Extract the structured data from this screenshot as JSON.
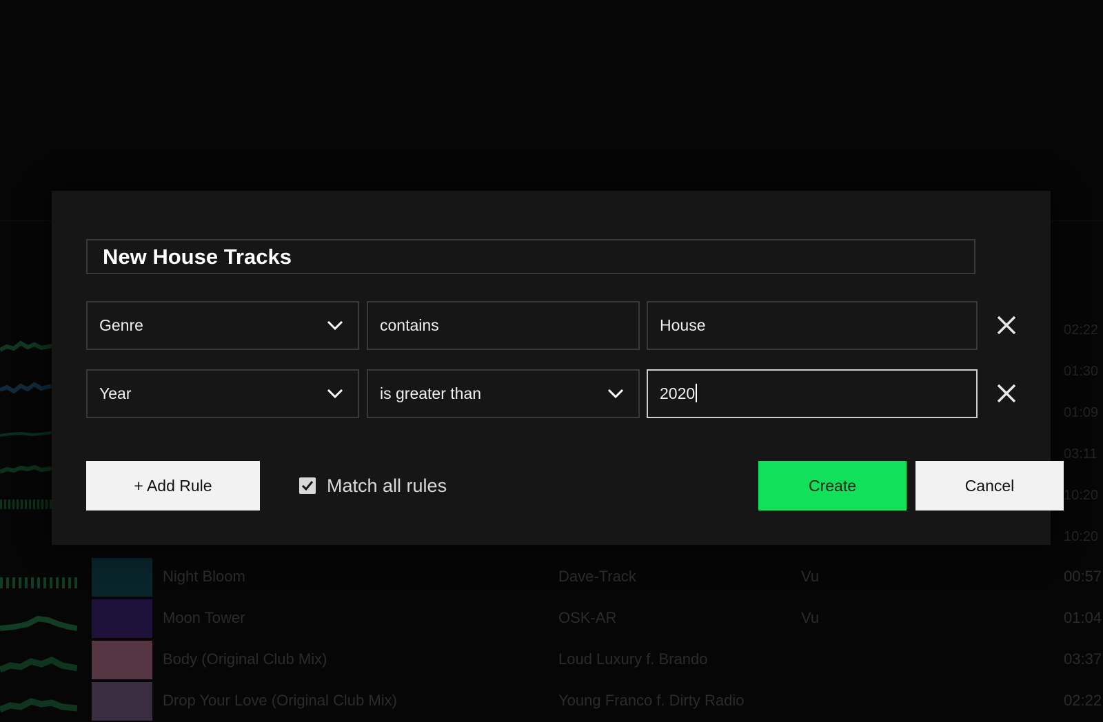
{
  "dialog": {
    "playlist_name": "New House Tracks",
    "rules": [
      {
        "field": "Genre",
        "operator": "contains",
        "value": "House"
      },
      {
        "field": "Year",
        "operator": "is greater than",
        "value": "2020"
      }
    ],
    "add_rule_label": "+ Add Rule",
    "match_all_label": "Match all rules",
    "match_all_checked": true,
    "create_label": "Create",
    "cancel_label": "Cancel"
  },
  "background_tracks": [
    {
      "title": "Night Bloom",
      "artist": "Dave-Track",
      "label": "Vu",
      "time": "00:57"
    },
    {
      "title": "Moon Tower",
      "artist": "OSK-AR",
      "label": "Vu",
      "time": "01:04"
    },
    {
      "title": "Body (Original Club Mix)",
      "artist": "Loud Luxury f. Brando",
      "label": "",
      "time": "03:37"
    },
    {
      "title": "Drop Your Love (Original Club Mix)",
      "artist": "Young Franco f. Dirty Radio",
      "label": "",
      "time": "02:22"
    }
  ],
  "background_times": [
    "02:22",
    "01:30",
    "01:09",
    "03:11",
    "10:20",
    "10:20"
  ],
  "colors": {
    "accent": "#10e05a",
    "dialog_bg": "#161616",
    "page_bg": "#060606"
  }
}
